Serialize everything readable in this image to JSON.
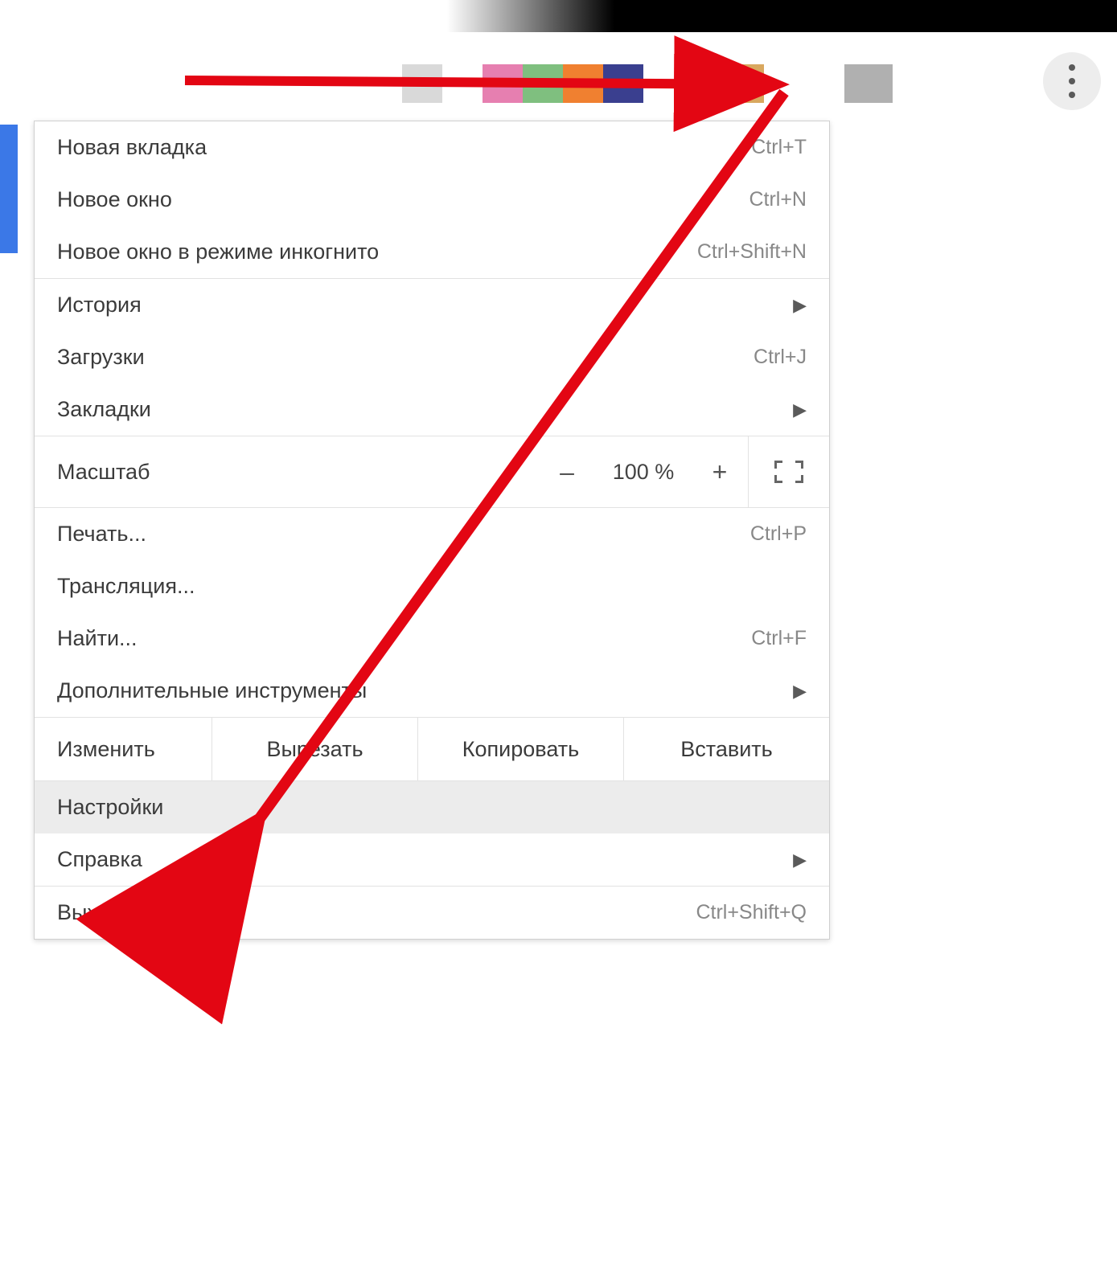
{
  "menu": {
    "new_tab": {
      "label": "Новая вкладка",
      "shortcut": "Ctrl+T"
    },
    "new_window": {
      "label": "Новое окно",
      "shortcut": "Ctrl+N"
    },
    "new_incognito": {
      "label": "Новое окно в режиме инкогнито",
      "shortcut": "Ctrl+Shift+N"
    },
    "history": {
      "label": "История"
    },
    "downloads": {
      "label": "Загрузки",
      "shortcut": "Ctrl+J"
    },
    "bookmarks": {
      "label": "Закладки"
    },
    "zoom": {
      "label": "Масштаб",
      "value": "100 %",
      "minus": "–",
      "plus": "+"
    },
    "print": {
      "label": "Печать...",
      "shortcut": "Ctrl+P"
    },
    "cast": {
      "label": "Трансляция..."
    },
    "find": {
      "label": "Найти...",
      "shortcut": "Ctrl+F"
    },
    "more_tools": {
      "label": "Дополнительные инструменты"
    },
    "edit": {
      "label": "Изменить",
      "cut": "Вырезать",
      "copy": "Копировать",
      "paste": "Вставить"
    },
    "settings": {
      "label": "Настройки"
    },
    "help": {
      "label": "Справка"
    },
    "exit": {
      "label": "Выход",
      "shortcut": "Ctrl+Shift+Q"
    }
  },
  "annotation": {
    "arrow_color": "#e30613"
  }
}
